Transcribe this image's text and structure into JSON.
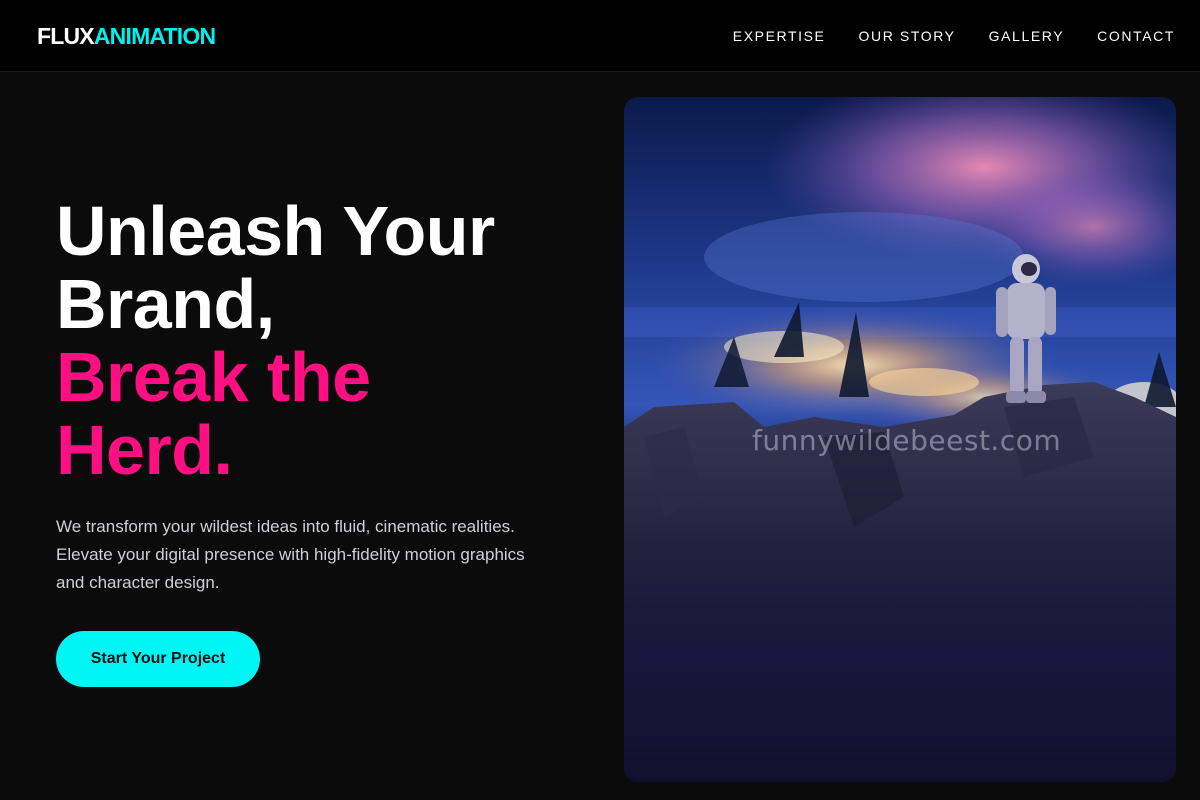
{
  "brand": {
    "logo_part_a": "FLUX",
    "logo_part_b": "ANIMATION",
    "accent_color": "#00f0f0",
    "highlight_color": "#ff0f82"
  },
  "nav": {
    "items": [
      {
        "label": "EXPERTISE"
      },
      {
        "label": "OUR STORY"
      },
      {
        "label": "GALLERY"
      },
      {
        "label": "CONTACT"
      }
    ]
  },
  "hero": {
    "headline_lines": [
      "Unleash Your",
      "Brand,"
    ],
    "highlight_lines": [
      "Break the",
      "Herd."
    ],
    "description": "We transform your wildest ideas into fluid, cinematic realities. Elevate your digital presence with high-fidelity motion graphics and character design.",
    "cta_label": "Start Your Project"
  },
  "image": {
    "watermark": "funnywildebeest.com",
    "subject": "astronaut on cliff overlooking city lights at night"
  }
}
